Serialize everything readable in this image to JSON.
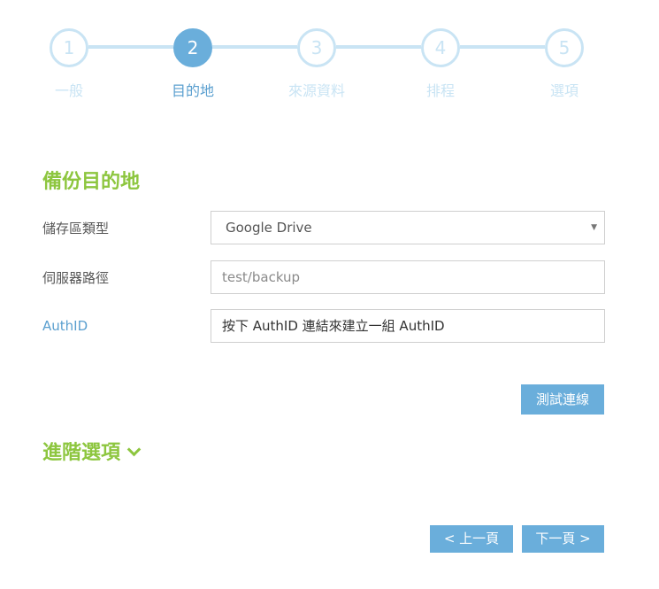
{
  "stepper": {
    "steps": [
      {
        "number": "1",
        "label": "一般",
        "active": false
      },
      {
        "number": "2",
        "label": "目的地",
        "active": true
      },
      {
        "number": "3",
        "label": "來源資料",
        "active": false
      },
      {
        "number": "4",
        "label": "排程",
        "active": false
      },
      {
        "number": "5",
        "label": "選項",
        "active": false
      }
    ]
  },
  "section": {
    "title": "備份目的地"
  },
  "form": {
    "storage_type": {
      "label": "儲存區類型",
      "value": "Google Drive"
    },
    "server_path": {
      "label": "伺服器路徑",
      "placeholder": "test/backup"
    },
    "authid": {
      "label": "AuthID",
      "value": "按下 AuthID 連結來建立一組 AuthID"
    }
  },
  "buttons": {
    "test_connection": "測試連線",
    "prev": "< 上一頁",
    "next": "下一頁 >"
  },
  "advanced": {
    "title": "進階選項"
  },
  "colors": {
    "accent_blue": "#6aaedb",
    "inactive_step": "#c9e4f4",
    "section_green": "#8dc63f"
  }
}
